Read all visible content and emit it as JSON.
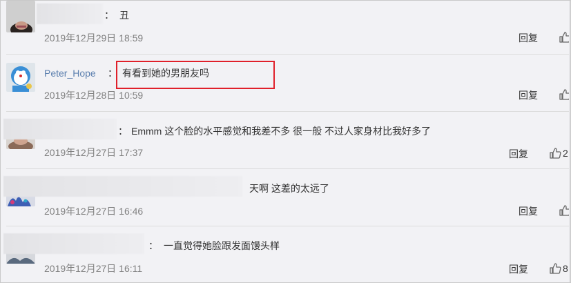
{
  "comments": [
    {
      "user": "",
      "text": "丑",
      "time": "2019年12月29日 18:59",
      "reply": "回复",
      "likes": ""
    },
    {
      "user": "Peter_Hope",
      "text": "有看到她的男朋友吗",
      "time": "2019年12月28日 10:59",
      "reply": "回复",
      "likes": ""
    },
    {
      "user": "",
      "text": "Emmm 这个脸的水平感觉和我差不多 很一般 不过人家身材比我好多了",
      "time": "2019年12月27日 17:37",
      "reply": "回复",
      "likes": "2"
    },
    {
      "user": "",
      "text": "天啊 这差的太远了",
      "time": "2019年12月27日 16:46",
      "reply": "回复",
      "likes": ""
    },
    {
      "user": "",
      "text": "一直觉得她脸跟发面馒头样",
      "time": "2019年12月27日 16:11",
      "reply": "回复",
      "likes": "8"
    }
  ],
  "colon": "：",
  "icons": {
    "like": "thumbs-up-icon"
  },
  "colors": {
    "username": "#5b7fae",
    "highlight": "#e0202a"
  }
}
